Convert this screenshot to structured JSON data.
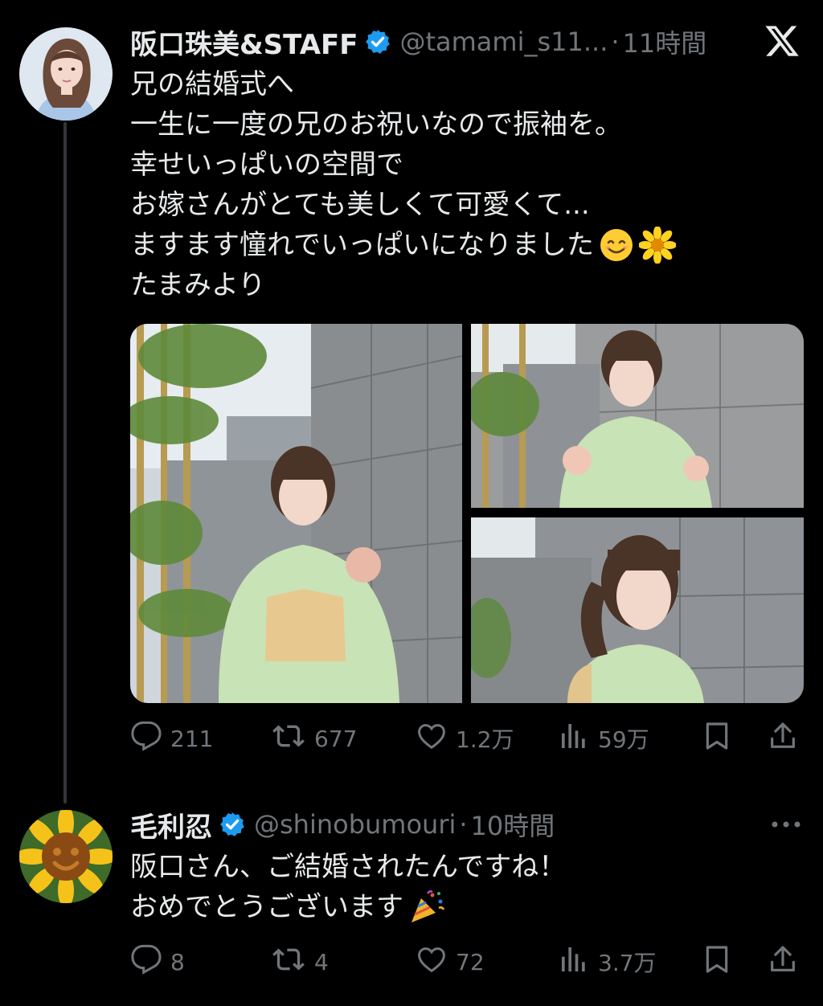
{
  "tweet": {
    "display_name": "阪口珠美&STAFF",
    "handle": "@tamami_s11...",
    "separator": "·",
    "time": "11時間",
    "text_lines": [
      "兄の結婚式へ",
      "一生に一度の兄のお祝いなので振袖を。",
      "幸せいっぱいの空間で",
      "お嫁さんがとても美しくて可愛くて...",
      "ますます憧れでいっぱいになりました",
      "たまみより"
    ],
    "emojis": [
      "smiling-face-emoji",
      "blossom-emoji"
    ],
    "actions": {
      "reply_count": "211",
      "retweet_count": "677",
      "like_count": "1.2万",
      "views_count": "59万"
    }
  },
  "reply": {
    "display_name": "毛利忍",
    "handle": "@shinobumouri",
    "separator": "·",
    "time": "10時間",
    "text_lines": [
      "阪口さん、ご結婚されたんですね！",
      "おめでとうございます"
    ],
    "emojis": [
      "party-popper-emoji"
    ],
    "actions": {
      "reply_count": "8",
      "retweet_count": "4",
      "like_count": "72",
      "views_count": "3.7万"
    }
  },
  "colors": {
    "background": "#000000",
    "text_primary": "#e7e9ea",
    "text_secondary": "#71767b",
    "verified_blue": "#1d9bf0",
    "thread_line": "#333639"
  }
}
